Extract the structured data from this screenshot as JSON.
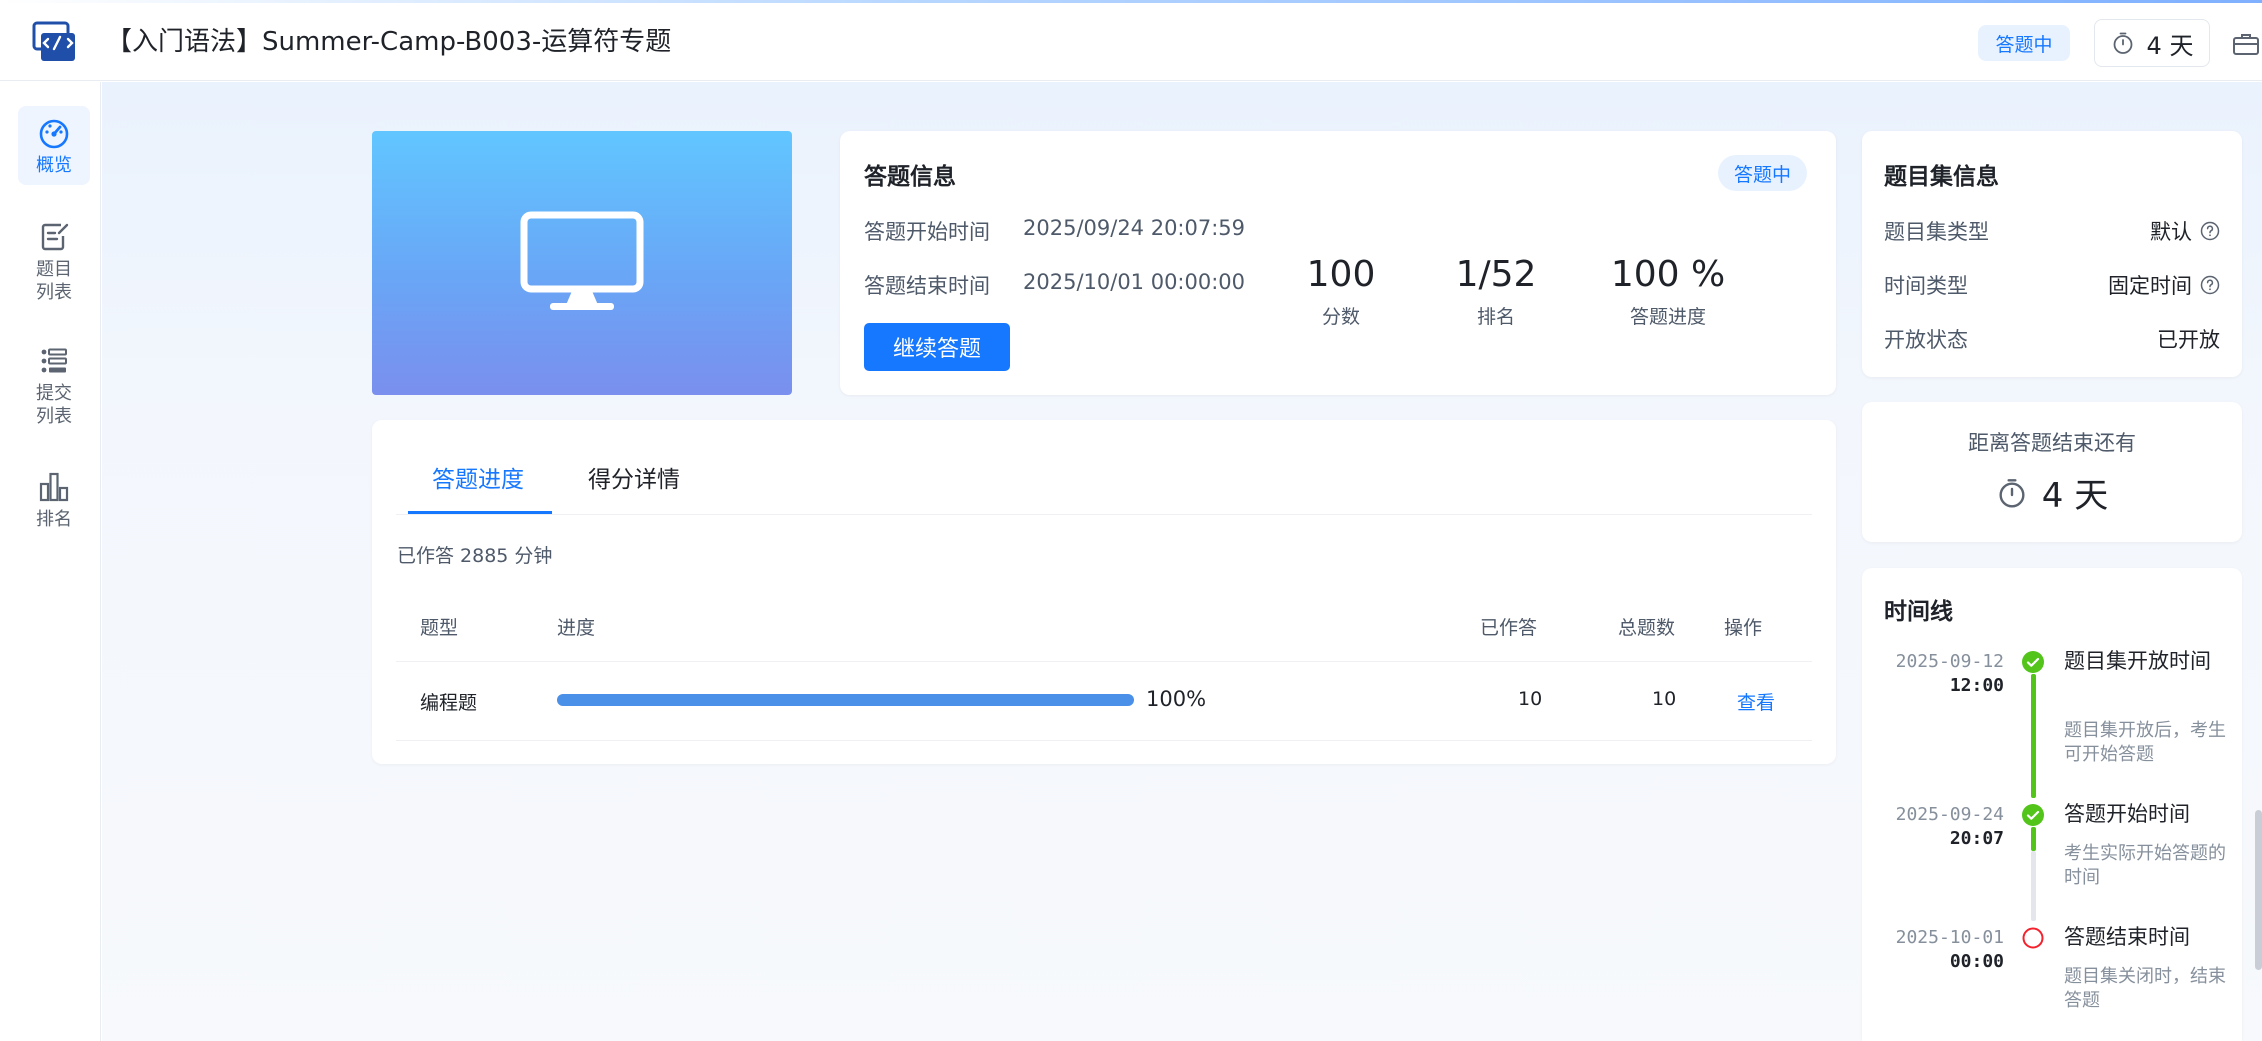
{
  "header": {
    "title": "【入门语法】Summer-Camp-B003-运算符专题",
    "status": "答题中",
    "countdown": "4 天"
  },
  "sidebar": {
    "items": [
      {
        "label": "概览",
        "icon": "dashboard-icon",
        "active": true
      },
      {
        "label": "题目列表",
        "icon": "edit-note-icon",
        "active": false
      },
      {
        "label": "提交列表",
        "icon": "list-icon",
        "active": false
      },
      {
        "label": "排名",
        "icon": "bar-chart-icon",
        "active": false
      }
    ]
  },
  "answer_info": {
    "title": "答题信息",
    "status": "答题中",
    "start_label": "答题开始时间",
    "start_value": "2025/09/24 20:07:59",
    "end_label": "答题结束时间",
    "end_value": "2025/10/01 00:00:00",
    "continue_button": "继续答题",
    "stats": [
      {
        "value": "100",
        "label": "分数"
      },
      {
        "value": "1/52",
        "label": "排名"
      },
      {
        "value": "100 %",
        "label": "答题进度"
      }
    ]
  },
  "progress_card": {
    "tabs": [
      "答题进度",
      "得分详情"
    ],
    "active_tab": 0,
    "elapsed": "已作答 2885 分钟",
    "columns": {
      "type": "题型",
      "progress": "进度",
      "answered": "已作答",
      "total": "总题数",
      "action": "操作"
    },
    "rows": [
      {
        "type": "编程题",
        "progress": 1.0,
        "progress_text": "100%",
        "answered": "10",
        "total": "10",
        "action": "查看"
      }
    ]
  },
  "set_info": {
    "title": "题目集信息",
    "rows": [
      {
        "label": "题目集类型",
        "value": "默认",
        "help": true
      },
      {
        "label": "时间类型",
        "value": "固定时间",
        "help": true
      },
      {
        "label": "开放状态",
        "value": "已开放",
        "help": false
      }
    ]
  },
  "countdown_card": {
    "title": "距离答题结束还有",
    "value": "4 天"
  },
  "timeline": {
    "title": "时间线",
    "events": [
      {
        "date": "2025-09-12",
        "time": "12:00",
        "title": "题目集开放时间",
        "desc": "题目集开放后，考生可开始答题",
        "status": "done"
      },
      {
        "date": "2025-09-24",
        "time": "20:07",
        "title": "答题开始时间",
        "desc": "考生实际开始答题的时间",
        "status": "done"
      },
      {
        "date": "2025-10-01",
        "time": "00:00",
        "title": "答题结束时间",
        "desc": "题目集关闭时，结束答题",
        "status": "pending"
      }
    ]
  },
  "colors": {
    "accent": "#1677ff",
    "success": "#52c41a",
    "danger": "#f5222d"
  }
}
